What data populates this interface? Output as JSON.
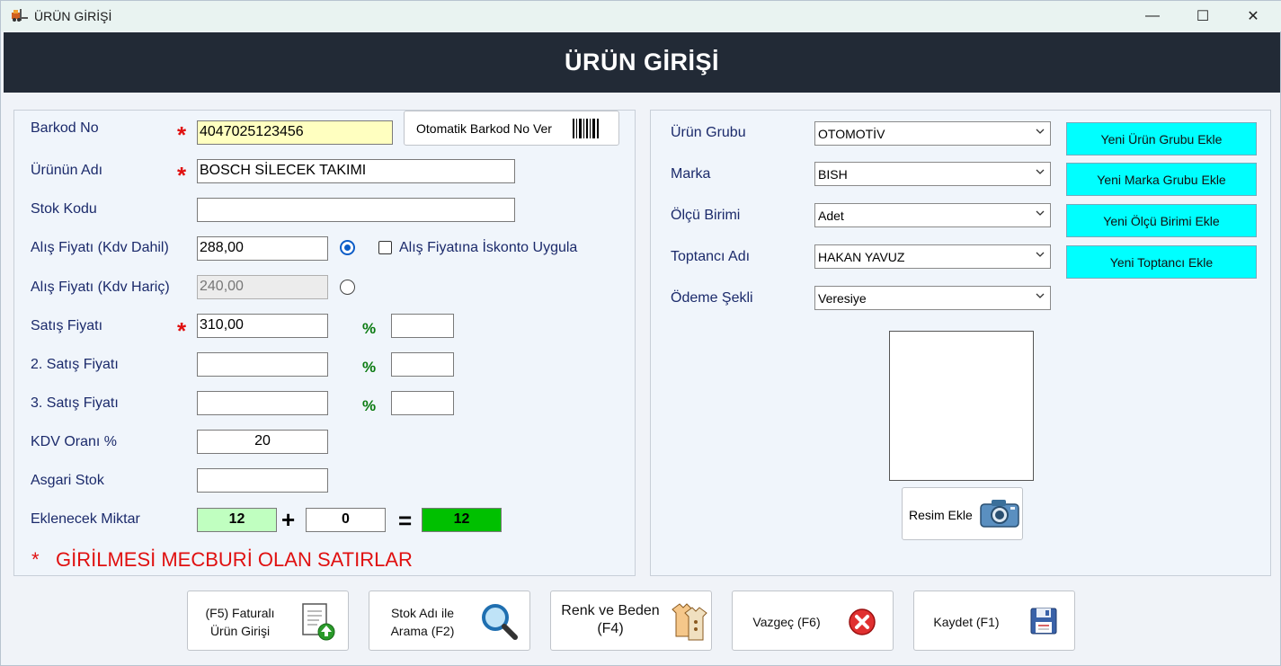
{
  "window": {
    "title": "ÜRÜN GİRİŞİ",
    "minimize": "—",
    "maximize": "☐",
    "close": "✕"
  },
  "header": {
    "title": "ÜRÜN GİRİŞİ"
  },
  "left": {
    "barcode_label": "Barkod No",
    "barcode_value": "4047025123456",
    "auto_barcode_button": "Otomatik Barkod No Ver",
    "name_label": "Ürünün Adı",
    "name_value": "BOSCH SİLECEK TAKIMI",
    "stock_code_label": "Stok Kodu",
    "stock_code_value": "",
    "buy_incl_label": "Alış Fiyatı (Kdv Dahil)",
    "buy_incl_value": "288,00",
    "discount_checkbox_label": "Alış Fiyatına İskonto Uygula",
    "buy_excl_label": "Alış Fiyatı (Kdv Hariç)",
    "buy_excl_value": "240,00",
    "sale_label": "Satış Fiyatı",
    "sale_value": "310,00",
    "sale2_label": "2. Satış Fiyatı",
    "sale3_label": "3. Satış Fiyatı",
    "percent_symbol": "%",
    "vat_label": "KDV Oranı %",
    "vat_value": "20",
    "min_stock_label": "Asgari Stok",
    "add_qty_label": "Eklenecek Miktar",
    "qty_current": "12",
    "qty_add": "0",
    "qty_total": "12",
    "plus": "+",
    "equals": "=",
    "required_star": "*",
    "required_note": "GİRİLMESİ MECBURİ OLAN SATIRLAR"
  },
  "right": {
    "group_label": "Ürün Grubu",
    "group_value": "OTOMOTİV",
    "brand_label": "Marka",
    "brand_value": "BISH",
    "unit_label": "Ölçü Birimi",
    "unit_value": "Adet",
    "supplier_label": "Toptancı Adı",
    "supplier_value": "HAKAN YAVUZ",
    "payment_label": "Ödeme Şekli",
    "payment_value": "Veresiye",
    "new_group_button": "Yeni Ürün Grubu Ekle",
    "new_brand_button": "Yeni Marka Grubu Ekle",
    "new_unit_button": "Yeni Ölçü Birimi Ekle",
    "new_supplier_button": "Yeni Toptancı Ekle",
    "add_image_button": "Resim Ekle"
  },
  "footer": {
    "invoice_line1": "(F5) Faturalı",
    "invoice_line2": "Ürün Girişi",
    "search_line1": "Stok Adı ile",
    "search_line2": "Arama (F2)",
    "variant_line1": "Renk ve Beden",
    "variant_line2": "(F4)",
    "cancel": "Vazgeç (F6)",
    "save": "Kaydet (F1)"
  },
  "colors": {
    "header_bg": "#222a36",
    "accent_cyan": "#00ffff",
    "required_red": "#e01010",
    "percent_green": "#0a7a10",
    "qty_light_green": "#c0ffc0",
    "qty_green": "#00c000",
    "barcode_yellow": "#ffffc0"
  }
}
